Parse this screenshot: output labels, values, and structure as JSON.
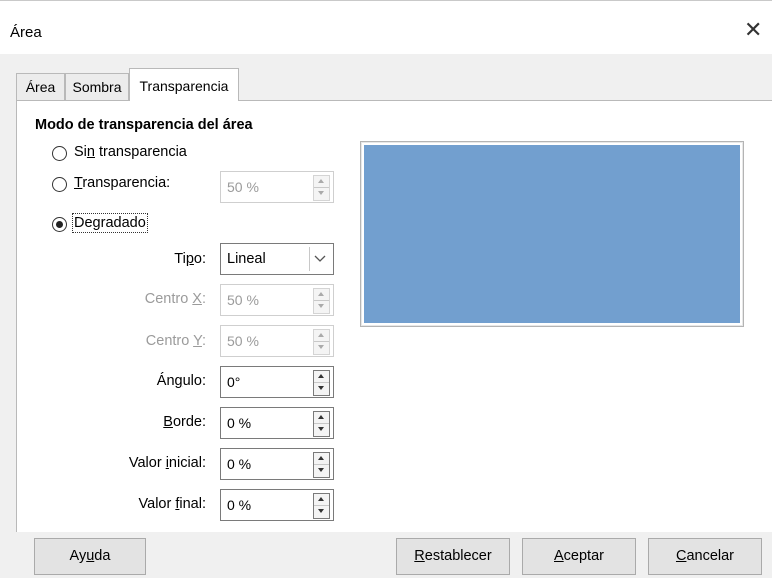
{
  "window": {
    "title": "Área",
    "close_glyph": "✕"
  },
  "tabs": [
    {
      "label": "Área",
      "active": false
    },
    {
      "label": "Sombra",
      "active": false
    },
    {
      "label": "Transparencia",
      "active": true
    }
  ],
  "section": {
    "title": "Modo de transparencia del área"
  },
  "radios": {
    "none": {
      "pre": "Si",
      "mn": "n",
      "post": " transparencia",
      "checked": false
    },
    "transparency": {
      "pre": "",
      "mn": "T",
      "post": "ransparencia:",
      "checked": false
    },
    "gradient": {
      "pre": "De",
      "mn": "g",
      "post": "radado",
      "checked": true
    }
  },
  "transparency_value": "50 %",
  "fields": {
    "type": {
      "pre": "Ti",
      "mn": "p",
      "post": "o:",
      "value": "Lineal"
    },
    "center_x": {
      "pre": "Centro ",
      "mn": "X",
      "post": ":",
      "value": "50 %"
    },
    "center_y": {
      "pre": "Centro ",
      "mn": "Y",
      "post": ":",
      "value": "50 %"
    },
    "angle": {
      "pre": "Án",
      "mn": "g",
      "post": "ulo:",
      "value": "0°"
    },
    "border": {
      "pre": "",
      "mn": "B",
      "post": "orde:",
      "value": "0 %"
    },
    "start": {
      "pre": "Valor ",
      "mn": "i",
      "post": "nicial:",
      "value": "0 %"
    },
    "end": {
      "pre": "Valor ",
      "mn": "f",
      "post": "inal:",
      "value": "0 %"
    }
  },
  "preview": {
    "color": "#729fcf",
    "icon": "preview-swatch"
  },
  "buttons": {
    "help": {
      "pre": "Ay",
      "mn": "u",
      "post": "da"
    },
    "reset": {
      "pre": "",
      "mn": "R",
      "post": "establecer"
    },
    "ok": {
      "pre": "",
      "mn": "A",
      "post": "ceptar"
    },
    "cancel": {
      "pre": "",
      "mn": "C",
      "post": "ancelar"
    }
  }
}
